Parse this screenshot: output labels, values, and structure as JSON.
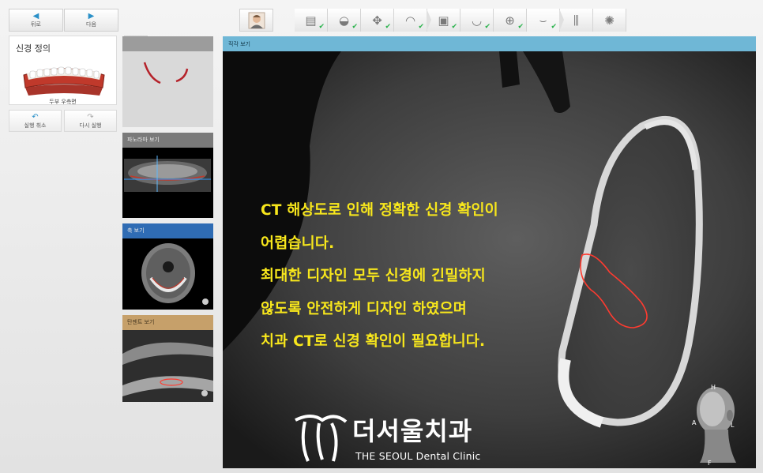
{
  "toolbar": {
    "back_label": "뒤로",
    "next_label": "다음"
  },
  "workflow_steps": [
    {
      "name": "patient-info",
      "glyph": "▤",
      "checked": true
    },
    {
      "name": "scan-import",
      "glyph": "◒",
      "checked": true
    },
    {
      "name": "tooth-selection",
      "glyph": "✥",
      "checked": true
    },
    {
      "name": "crown-design",
      "glyph": "◠",
      "checked": true
    },
    {
      "name": "ct-import",
      "glyph": "▣",
      "checked": true
    },
    {
      "name": "arch-design",
      "glyph": "◡",
      "checked": true
    },
    {
      "name": "implant-plan",
      "glyph": "⊕",
      "checked": true
    },
    {
      "name": "nerve-definition",
      "glyph": "⌣",
      "checked": true
    },
    {
      "name": "implant-placement",
      "glyph": "⫼",
      "checked": false
    },
    {
      "name": "guide-export",
      "glyph": "✺",
      "checked": false
    }
  ],
  "left_panel": {
    "title": "신경 정의",
    "caption": "두부 우측면",
    "undo_label": "실행 취소",
    "redo_label": "다시 실행",
    "info_label": "i"
  },
  "thumbnails": {
    "panorama_label": "파노라마 보기",
    "axial_label": "축 보기",
    "tangential_label": "탄젠트 보기"
  },
  "viewport": {
    "header": "직각 보기",
    "overlay_lines": [
      "CT 해상도로 인해 정확한 신경 확인이",
      "어렵습니다.",
      "최대한 디자인 모두 신경에 긴밀하지",
      "않도록 안전하게 디자인 하였으며",
      "치과 CT로 신경 확인이 필요합니다."
    ],
    "logo_ko": "더서울치과",
    "logo_en": "THE SEOUL Dental Clinic",
    "orient": {
      "top": "H",
      "left": "A",
      "right": "L",
      "bottom": "F"
    }
  },
  "colors": {
    "accent": "#2a90c8",
    "check": "#27b24a",
    "nerve": "#ff3b30",
    "overlay_text": "#f8e71c",
    "viewport_header": "#6fb7d6"
  }
}
